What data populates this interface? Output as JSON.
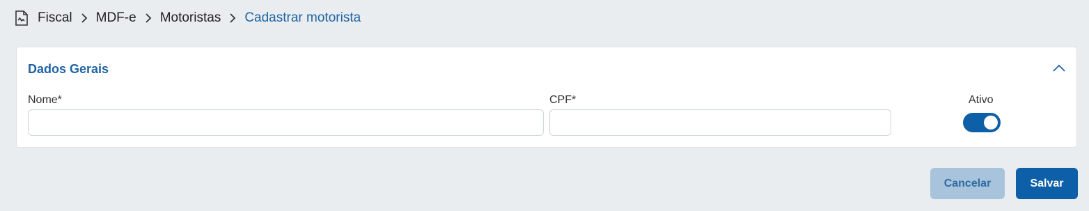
{
  "breadcrumb": {
    "icon": "fiscal-document-icon",
    "items": [
      "Fiscal",
      "MDF-e",
      "Motoristas"
    ],
    "current": "Cadastrar motorista",
    "separator_icon": "chevron-right-icon"
  },
  "card": {
    "title": "Dados Gerais",
    "collapse_icon": "chevron-up-icon",
    "fields": {
      "nome": {
        "label": "Nome*",
        "value": "",
        "placeholder": ""
      },
      "cpf": {
        "label": "CPF*",
        "value": "",
        "placeholder": ""
      },
      "ativo": {
        "label": "Ativo",
        "checked": true
      }
    }
  },
  "actions": {
    "cancel_label": "Cancelar",
    "save_label": "Salvar"
  },
  "colors": {
    "accent": "#0d5fa7",
    "link": "#1f63a5",
    "cancel_bg": "#a7c4dc",
    "page_bg": "#eaedef"
  }
}
